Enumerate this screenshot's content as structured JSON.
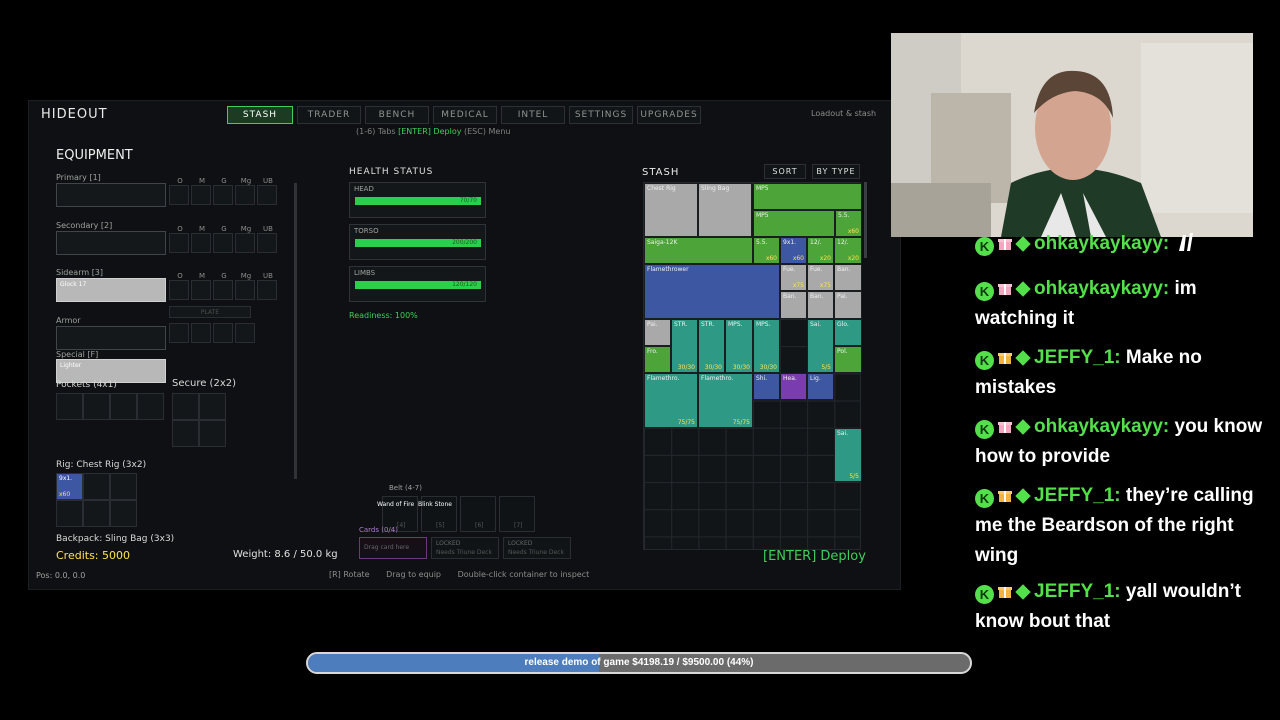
{
  "game": {
    "title": "HIDEOUT",
    "tabs": [
      {
        "label": "STASH",
        "active": true
      },
      {
        "label": "TRADER",
        "active": false
      },
      {
        "label": "BENCH",
        "active": false
      },
      {
        "label": "MEDICAL",
        "active": false
      },
      {
        "label": "INTEL",
        "active": false
      },
      {
        "label": "SETTINGS",
        "active": false
      },
      {
        "label": "UPGRADES",
        "active": false
      }
    ],
    "hint_prefix": "(1-6) Tabs ",
    "hint_enter": "[ENTER] Deploy",
    "hint_suffix": " (ESC) Menu",
    "top_right": "Loadout & stash",
    "equipment": {
      "header": "EQUIPMENT",
      "slot_tags": [
        "O",
        "M",
        "G",
        "Mg",
        "UB"
      ],
      "slots": [
        {
          "label": "Primary [1]",
          "item": ""
        },
        {
          "label": "Secondary [2]",
          "item": ""
        },
        {
          "label": "Sidearm [3]",
          "item": "Glock 17"
        },
        {
          "label": "Armor",
          "item": ""
        },
        {
          "label": "Special [F]",
          "item": "Lighter"
        }
      ],
      "armor_sub": "PLATE",
      "pockets": "Pockets (4x1)",
      "secure": "Secure (2x2)",
      "rig": "Rig: Chest Rig (3x2)",
      "rig_item": {
        "name": "9x1.",
        "qty": "x60"
      },
      "backpack": "Backpack: Sling Bag (3x3)",
      "credits_label": "Credits:",
      "credits_value": "5000",
      "pos": "Pos: 0.0, 0.0"
    },
    "health": {
      "header": "HEALTH STATUS",
      "parts": [
        {
          "name": "HEAD",
          "value": "70/70",
          "fraction": 1.0
        },
        {
          "name": "TORSO",
          "value": "200/200",
          "fraction": 1.0
        },
        {
          "name": "LIMBS",
          "value": "120/120",
          "fraction": 1.0
        }
      ],
      "readiness": "Readiness: 100%"
    },
    "belt": {
      "label": "Belt (4-7)",
      "items": [
        "Wand of Fire",
        "Blink Stone",
        "",
        ""
      ],
      "keys": [
        "[4]",
        "[5]",
        "[6]",
        "[7]"
      ]
    },
    "cards": {
      "label": "Cards (0/4)",
      "slots": [
        {
          "title": "Drag card here",
          "sub": ""
        },
        {
          "title": "LOCKED",
          "sub": "Needs Triune Deck"
        },
        {
          "title": "LOCKED",
          "sub": "Needs Triune Deck"
        }
      ]
    },
    "weight": "Weight: 8.6 / 50.0 kg",
    "footer_hints": [
      "[R] Rotate",
      "Drag to equip",
      "Double-click container to inspect"
    ],
    "deploy": "[ENTER] Deploy",
    "stash": {
      "header": "STASH",
      "sort": "SORT",
      "by_type": "BY TYPE",
      "items": [
        {
          "name": "Chest Rig",
          "qty": "",
          "color": "gray"
        },
        {
          "name": "Sling Bag",
          "qty": "",
          "color": "gray"
        },
        {
          "name": "MP5",
          "qty": "",
          "color": "green"
        },
        {
          "name": "MP5",
          "qty": "",
          "color": "green"
        },
        {
          "name": "5.5.",
          "qty": "x60",
          "color": "green"
        },
        {
          "name": "Saiga-12K",
          "qty": "",
          "color": "green"
        },
        {
          "name": "5.5.",
          "qty": "x60",
          "color": "green"
        },
        {
          "name": "9x1.",
          "qty": "x60",
          "color": "blue"
        },
        {
          "name": "12/.",
          "qty": "x20",
          "color": "green"
        },
        {
          "name": "12/.",
          "qty": "x20",
          "color": "green"
        },
        {
          "name": "Flamethrower",
          "qty": "",
          "color": "blue"
        },
        {
          "name": "Fue.",
          "qty": "x75",
          "color": "gray"
        },
        {
          "name": "Fue.",
          "qty": "x75",
          "color": "gray"
        },
        {
          "name": "Ban.",
          "qty": "",
          "color": "gray"
        },
        {
          "name": "Ban.",
          "qty": "",
          "color": "gray"
        },
        {
          "name": "Ban.",
          "qty": "",
          "color": "gray"
        },
        {
          "name": "Pai.",
          "qty": "",
          "color": "gray"
        },
        {
          "name": "Pai.",
          "qty": "",
          "color": "gray"
        },
        {
          "name": "STR.",
          "qty": "30/30",
          "color": "teal"
        },
        {
          "name": "STR.",
          "qty": "30/30",
          "color": "teal"
        },
        {
          "name": "MPS.",
          "qty": "30/30",
          "color": "teal"
        },
        {
          "name": "MPS.",
          "qty": "30/30",
          "color": "teal"
        },
        {
          "name": "Sai.",
          "qty": "5/5",
          "color": "teal"
        },
        {
          "name": "Glo.",
          "qty": "",
          "color": "teal"
        },
        {
          "name": "Fro.",
          "qty": "",
          "color": "green"
        },
        {
          "name": "Pol.",
          "qty": "",
          "color": "green"
        },
        {
          "name": "Flamethro.",
          "qty": "75/75",
          "color": "teal"
        },
        {
          "name": "Flamethro.",
          "qty": "75/75",
          "color": "teal"
        },
        {
          "name": "Shi.",
          "qty": "",
          "color": "blue"
        },
        {
          "name": "Hea.",
          "qty": "",
          "color": "purple"
        },
        {
          "name": "Lig.",
          "qty": "",
          "color": "blue"
        },
        {
          "name": "Sai.",
          "qty": "5/5",
          "color": "teal"
        }
      ]
    }
  },
  "chat": [
    {
      "user": "ohkaykaykayy:",
      "msg": "",
      "gift_color": "#f4a7c0",
      "emote_icon": "hands-emote"
    },
    {
      "user": "ohkaykaykayy:",
      "msg": "im watching it",
      "gift_color": "#f4a7c0"
    },
    {
      "user": "JEFFY_1:",
      "msg": "Make no mistakes",
      "gift_color": "#f2b441"
    },
    {
      "user": "ohkaykaykayy:",
      "msg": "you know how to provide",
      "gift_color": "#f4a7c0"
    },
    {
      "user": "JEFFY_1:",
      "msg": "they’re calling me the Beardson of the right wing",
      "gift_color": "#f2b441"
    },
    {
      "user": "JEFFY_1:",
      "msg": "yall wouldn’t know bout that",
      "gift_color": "#f2b441"
    }
  ],
  "chat_badge_letter": "K",
  "goal": {
    "text": "release demo of game $4198.19 / $9500.00 (44%)",
    "progress": 0.44
  },
  "colors": {
    "accent_green": "#3fd05a",
    "credits_yellow": "#ffe34a",
    "deploy_green": "#3fd05a",
    "chat_green": "#53e04a"
  }
}
